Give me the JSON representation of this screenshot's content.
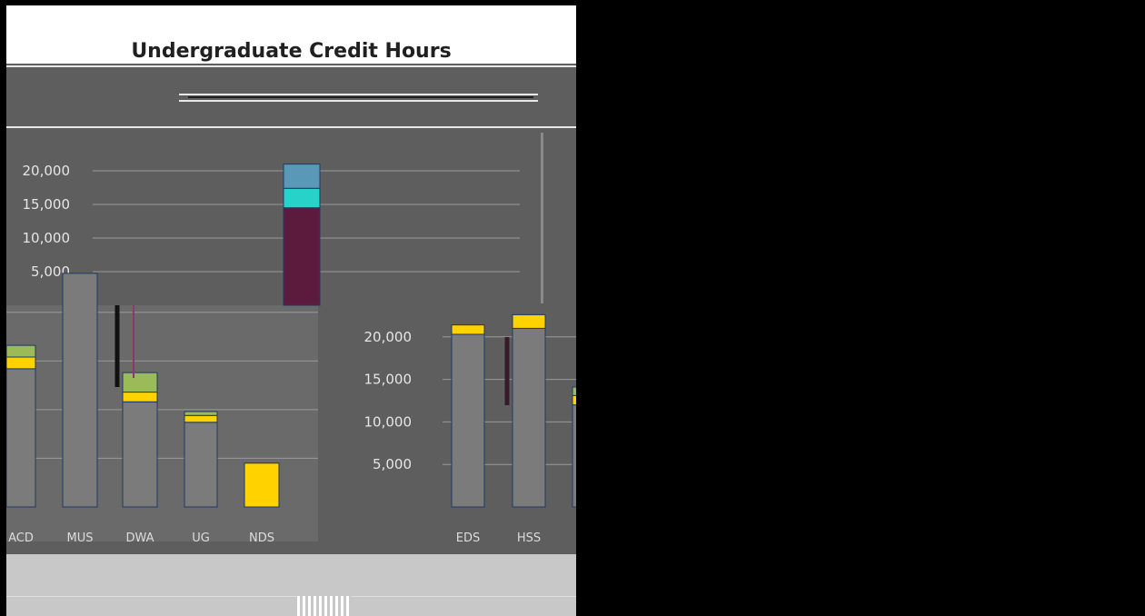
{
  "title": "Undergraduate Credit Hours",
  "colors": {
    "window_bg": "#5e5e5e",
    "panel_bg": "#6a6a6a",
    "base_fill": "#7b7b7b",
    "bar_outline": "#1f3864",
    "yellow": "#ffd200",
    "green": "#9bbb59",
    "maroon": "#5c1a3c",
    "teal": "#27d3c8",
    "blue": "#5a98b8",
    "grid": "#9a9a9a"
  },
  "chart_data": [
    {
      "type": "bar",
      "stacked": true,
      "title": "Undergraduate Credit Hours",
      "ylim": [
        0,
        25000
      ],
      "yticks": [
        "5,000",
        "10,000",
        "15,000",
        "20,000"
      ],
      "categories": [
        "",
        "",
        "",
        ""
      ],
      "series": [
        {
          "values": [
            0,
            0,
            0,
            14500
          ],
          "color": "#5c1a3c"
        },
        {
          "values": [
            0,
            0,
            0,
            2900
          ],
          "color": "#27d3c8"
        },
        {
          "values": [
            0,
            0,
            0,
            3600
          ],
          "color": "#5a98b8"
        }
      ]
    },
    {
      "type": "bar",
      "stacked": true,
      "ylim": [
        0,
        21000
      ],
      "categories": [
        "ACD",
        "MUS",
        "DWA",
        "UG",
        "NDS"
      ],
      "series": [
        {
          "values": [
            14200,
            24000,
            10800,
            8700,
            0
          ],
          "color": "#7b7b7b"
        },
        {
          "values": [
            1200,
            0,
            1000,
            700,
            4500
          ],
          "color": "#ffd200"
        },
        {
          "values": [
            1200,
            0,
            2000,
            400,
            0
          ],
          "color": "#9bbb59"
        }
      ]
    },
    {
      "type": "bar",
      "stacked": true,
      "ylim": [
        0,
        23500
      ],
      "yticks": [
        "5,000",
        "10,000",
        "15,000",
        "20,000"
      ],
      "categories": [
        "EDS",
        "HSS",
        ""
      ],
      "series": [
        {
          "values": [
            20300,
            21000,
            12000
          ],
          "color": "#7b7b7b"
        },
        {
          "values": [
            1100,
            1600,
            1100
          ],
          "color": "#ffd200"
        },
        {
          "values": [
            0,
            0,
            1000
          ],
          "color": "#9bbb59"
        }
      ]
    }
  ]
}
